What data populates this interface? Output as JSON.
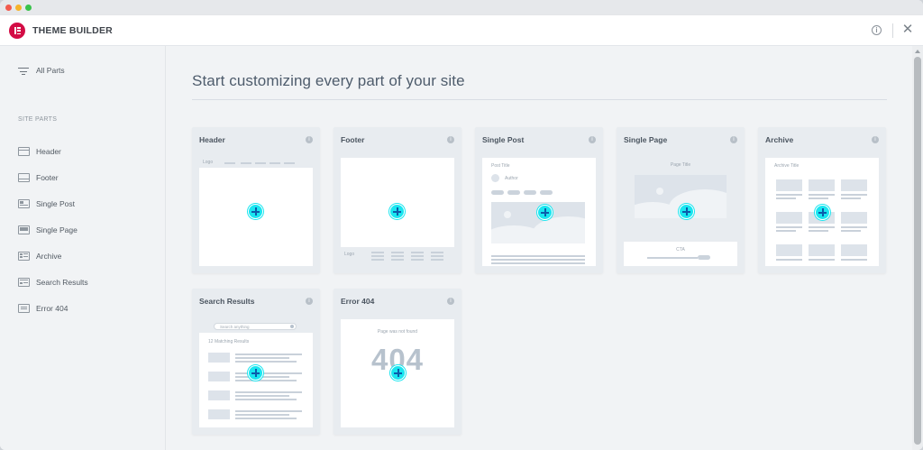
{
  "app": {
    "title": "THEME BUILDER",
    "logo_icon": "elementor-logo-icon",
    "accent_color": "#d30c45",
    "info_icon": "info-icon",
    "close_icon": "close-icon",
    "close_glyph": "✕",
    "info_glyph": "i"
  },
  "sidebar": {
    "all_parts_label": "All Parts",
    "section_heading": "SITE PARTS",
    "items": [
      {
        "label": "Header",
        "icon": "header-layout-icon"
      },
      {
        "label": "Footer",
        "icon": "footer-layout-icon"
      },
      {
        "label": "Single Post",
        "icon": "single-post-icon"
      },
      {
        "label": "Single Page",
        "icon": "single-page-icon"
      },
      {
        "label": "Archive",
        "icon": "archive-grid-icon"
      },
      {
        "label": "Search Results",
        "icon": "search-results-icon"
      },
      {
        "label": "Error 404",
        "icon": "error-404-icon"
      }
    ]
  },
  "main": {
    "title": "Start customizing every part of your site",
    "add_color": "#19e6f0",
    "cards": [
      {
        "title": "Header",
        "preview": {
          "logo": "Logo"
        }
      },
      {
        "title": "Footer",
        "preview": {
          "logo": "Logo"
        }
      },
      {
        "title": "Single Post",
        "preview": {
          "post_title": "Post Title",
          "author": "Author"
        }
      },
      {
        "title": "Single Page",
        "preview": {
          "page_title": "Page Title",
          "cta": "CTA"
        }
      },
      {
        "title": "Archive",
        "preview": {
          "archive_title": "Archive Title"
        }
      },
      {
        "title": "Search Results",
        "preview": {
          "search_placeholder": "Search anything",
          "results": "12 Matching Results"
        }
      },
      {
        "title": "Error 404",
        "preview": {
          "message": "Page was not found",
          "code": "404"
        }
      }
    ]
  }
}
